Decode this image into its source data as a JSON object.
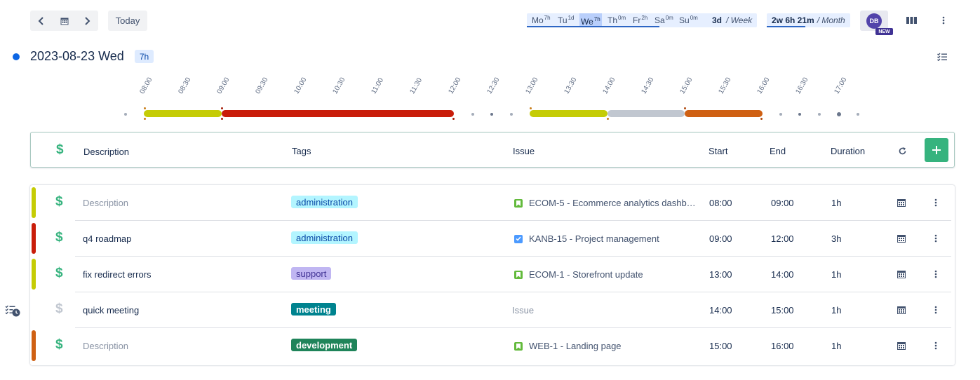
{
  "toolbar": {
    "today_label": "Today",
    "week": {
      "days": [
        {
          "day": "Mo",
          "hours": "7h"
        },
        {
          "day": "Tu",
          "hours": "1d"
        },
        {
          "day": "We",
          "hours": "7h"
        },
        {
          "day": "Th",
          "hours": "0m"
        },
        {
          "day": "Fr",
          "hours": "2h"
        },
        {
          "day": "Sa",
          "hours": "0m"
        },
        {
          "day": "Su",
          "hours": "0m"
        }
      ],
      "total": "3d",
      "period": "/ Week"
    },
    "month": {
      "total": "2w 6h 21m",
      "period": "/ Month"
    },
    "avatar_initials": "DB",
    "new_badge": "NEW"
  },
  "day": {
    "date": "2023-08-23 Wed",
    "total": "7h"
  },
  "timeline": {
    "labels": [
      "08:00",
      "08:30",
      "09:00",
      "09:30",
      "10:00",
      "10:30",
      "11:00",
      "11:30",
      "12:00",
      "12:30",
      "13:00",
      "13:30",
      "14:00",
      "14:30",
      "15:00",
      "15:30",
      "16:00",
      "16:30",
      "17:00"
    ]
  },
  "table": {
    "headers": {
      "description": "Description",
      "tags": "Tags",
      "issue": "Issue",
      "start": "Start",
      "end": "End",
      "duration": "Duration"
    },
    "dollar": "$",
    "rows": [
      {
        "description": "Description",
        "tag": "administration",
        "issue": "ECOM-5 - Ecommerce analytics dashb…",
        "start": "08:00",
        "end": "09:00",
        "duration": "1h"
      },
      {
        "description": "q4 roadmap",
        "tag": "administration",
        "issue": "KANB-15 - Project management",
        "start": "09:00",
        "end": "12:00",
        "duration": "3h"
      },
      {
        "description": "fix redirect errors",
        "tag": "support",
        "issue": "ECOM-1 - Storefront update",
        "start": "13:00",
        "end": "14:00",
        "duration": "1h"
      },
      {
        "description": "quick meeting",
        "tag": "meeting",
        "issue": "Issue",
        "start": "14:00",
        "end": "15:00",
        "duration": "1h"
      },
      {
        "description": "Description",
        "tag": "development",
        "issue": "WEB-1 - Landing page",
        "start": "15:00",
        "end": "16:00",
        "duration": "1h"
      }
    ]
  },
  "colors": {
    "olive": "#c5cc05",
    "red": "#c91d0a",
    "gray": "#c1c7d0",
    "orange": "#cf6013",
    "green": "#36b37e",
    "admin_tag_bg": "#b3f5ff",
    "support_tag_bg": "#c0b6f2",
    "meeting_tag_bg": "#00838f",
    "development_tag_bg": "#1f845a"
  }
}
